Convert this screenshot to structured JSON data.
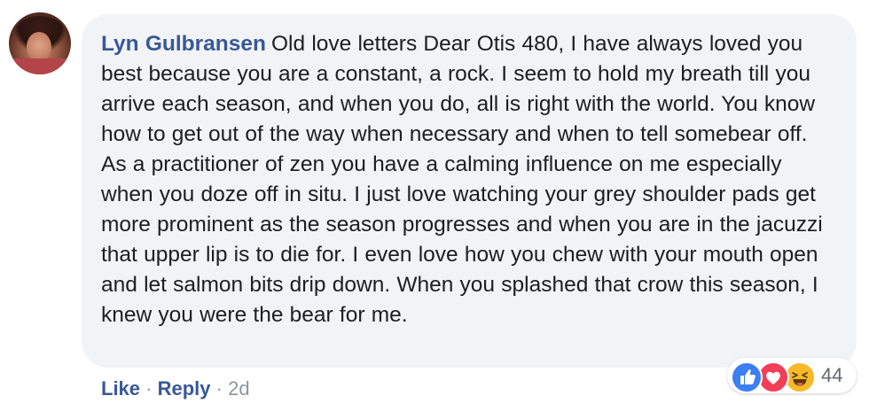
{
  "comment": {
    "author": "Lyn Gulbransen",
    "text": "Old love letters Dear Otis 480, I have always loved you best because you are a constant, a rock. I seem to hold my breath till you arrive each season, and when you do, all is right with the world. You know how to get out of the way when necessary and when to tell somebear off. As a practitioner of zen you have a calming influence on me especially when you doze off in situ. I just love watching your grey shoulder pads get more prominent as the season progresses and when you are in the jacuzzi that upper lip is to die for. I even love how you chew with your mouth open and let salmon bits drip down. When you splashed that crow this season, I knew you were the bear for me."
  },
  "actions": {
    "like_label": "Like",
    "separator": "·",
    "reply_label": "Reply",
    "time": "2d"
  },
  "reactions": {
    "icons": [
      "like-icon",
      "love-icon",
      "haha-icon"
    ],
    "count": "44"
  },
  "colors": {
    "author_link": "#385898",
    "bubble_bg": "#f2f3f5",
    "meta_gray": "#90949c",
    "like_blue": "#3b7ef5",
    "love_red": "#f33e58",
    "haha_yellow": "#f7b928"
  }
}
